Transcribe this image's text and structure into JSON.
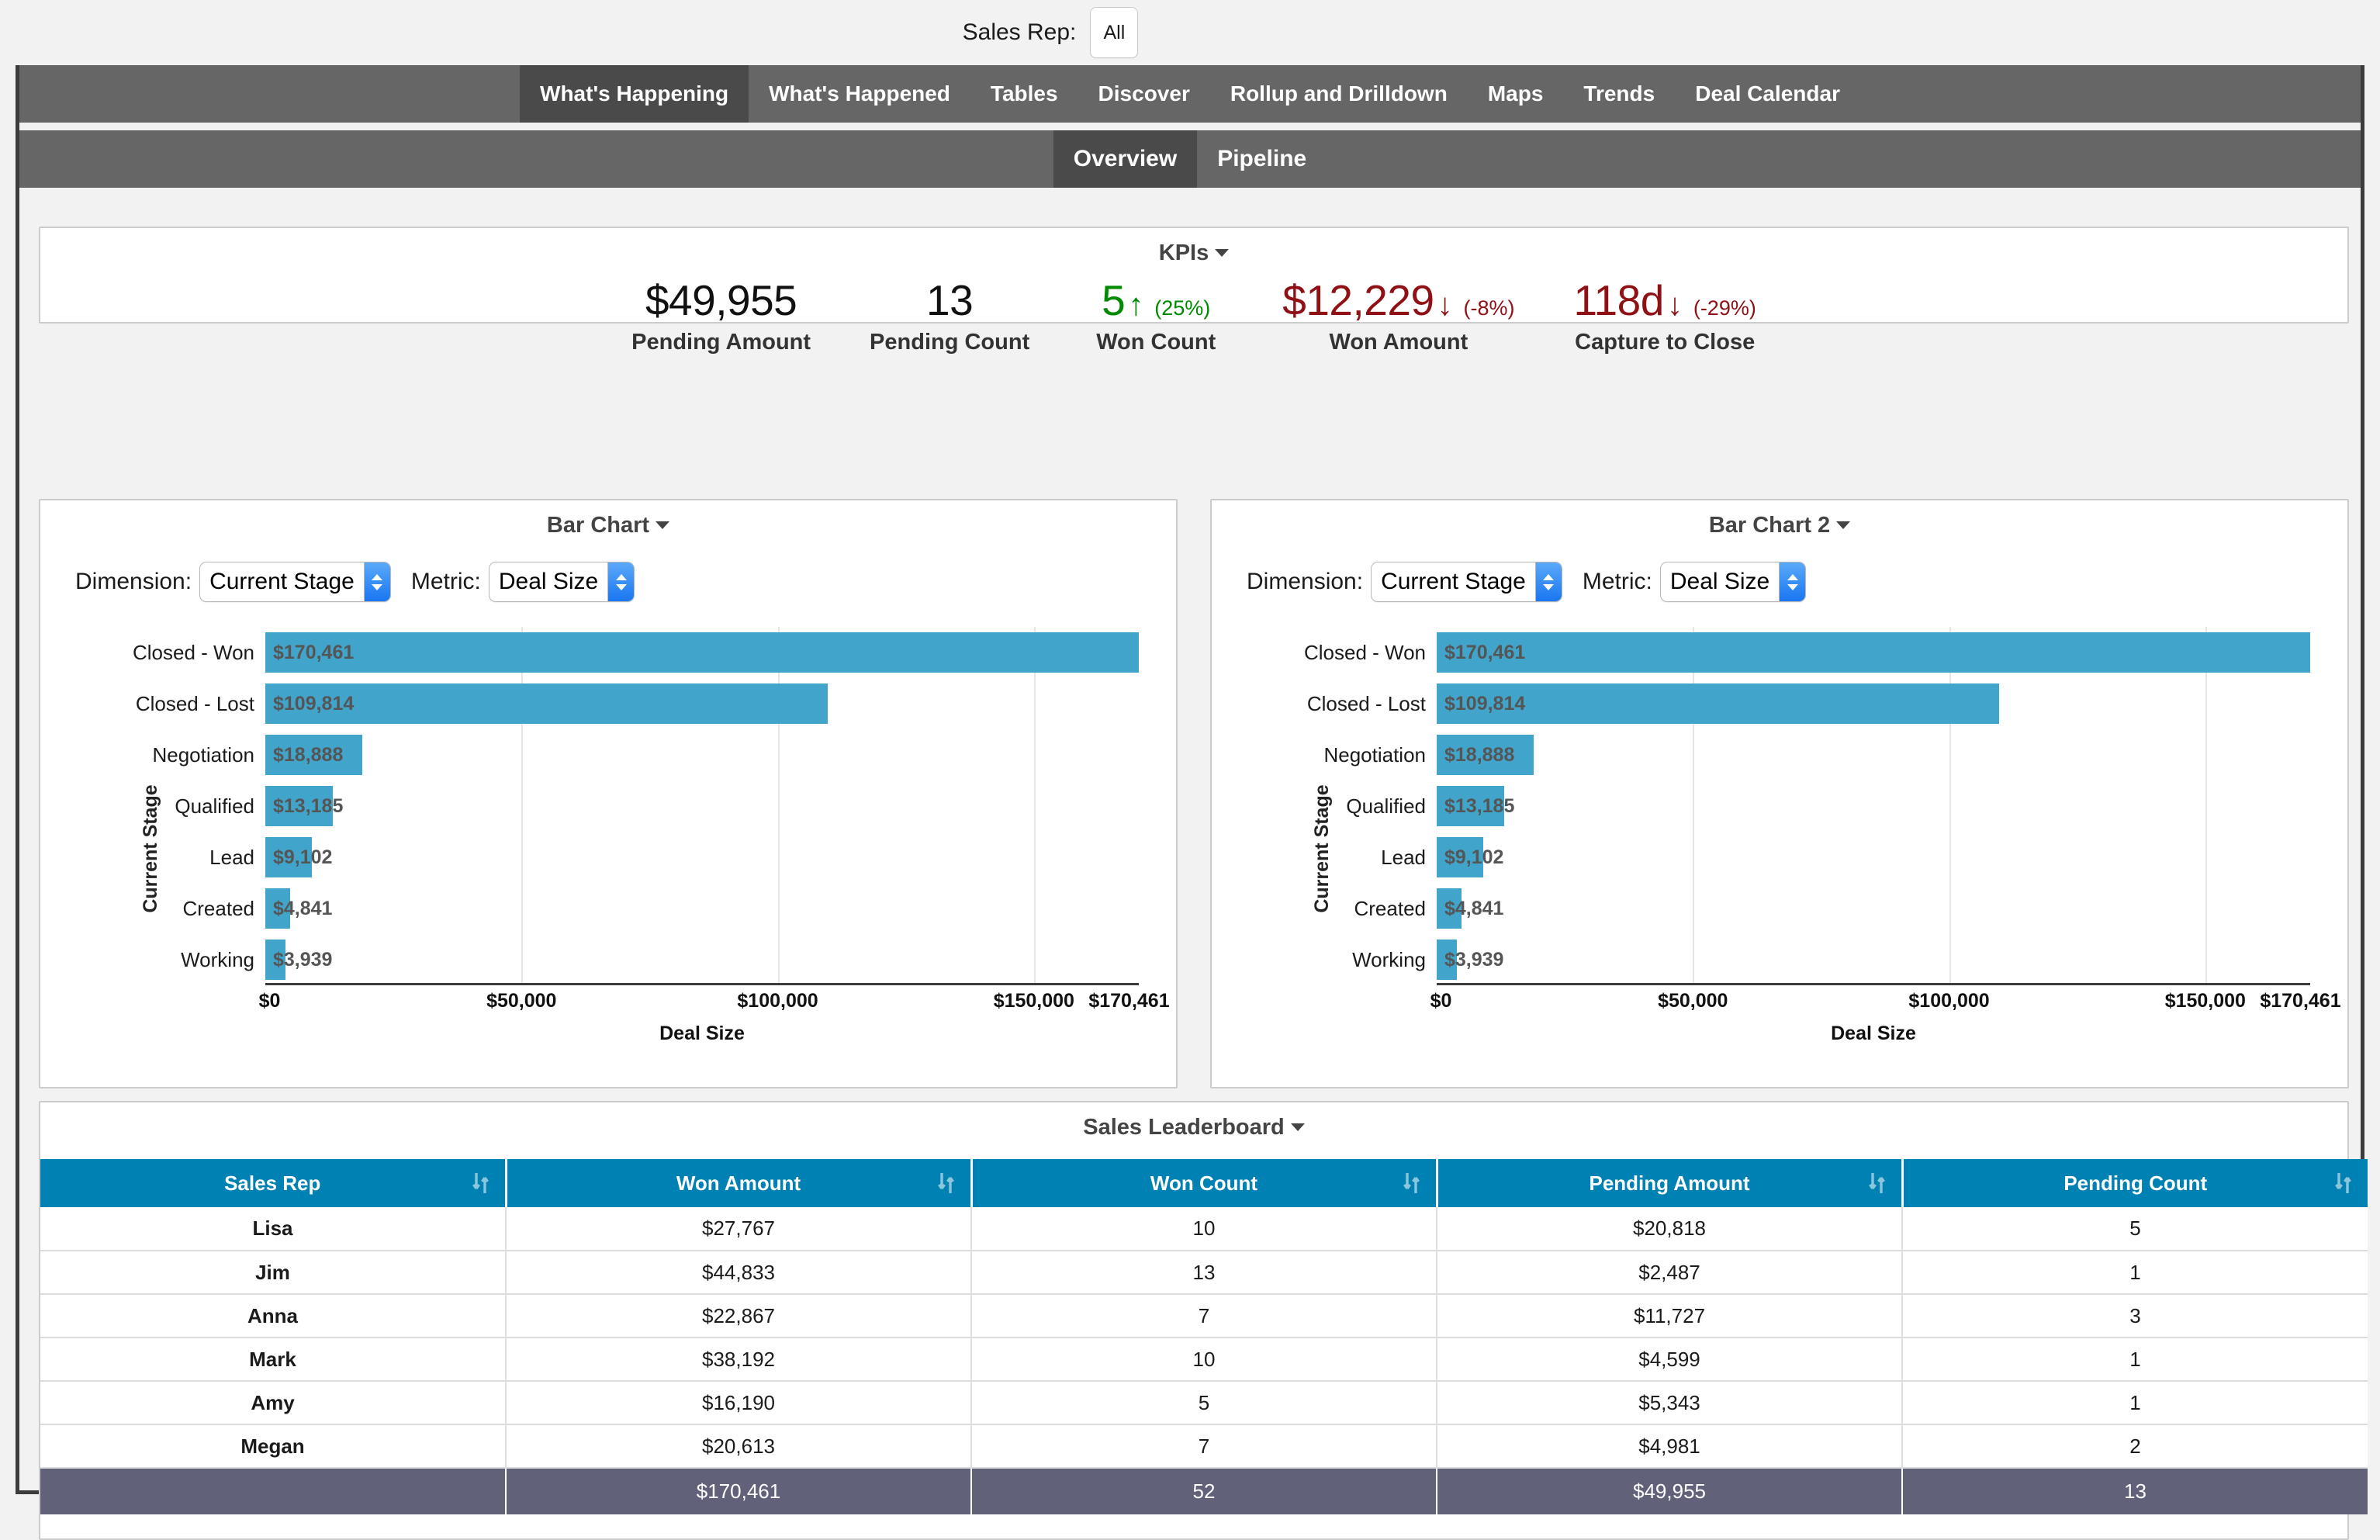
{
  "filter": {
    "label": "Sales Rep:",
    "value": "All"
  },
  "nav": {
    "items": [
      {
        "label": "What's Happening",
        "active": true
      },
      {
        "label": "What's Happened",
        "active": false
      },
      {
        "label": "Tables",
        "active": false
      },
      {
        "label": "Discover",
        "active": false
      },
      {
        "label": "Rollup and Drilldown",
        "active": false
      },
      {
        "label": "Maps",
        "active": false
      },
      {
        "label": "Trends",
        "active": false
      },
      {
        "label": "Deal Calendar",
        "active": false
      }
    ]
  },
  "subnav": {
    "items": [
      {
        "label": "Overview",
        "active": true
      },
      {
        "label": "Pipeline",
        "active": false
      }
    ]
  },
  "kpis": {
    "title": "KPIs",
    "items": [
      {
        "value": "$49,955",
        "label": "Pending Amount",
        "tone": "neutral",
        "arrow": "",
        "delta": ""
      },
      {
        "value": "13",
        "label": "Pending Count",
        "tone": "neutral",
        "arrow": "",
        "delta": ""
      },
      {
        "value": "5",
        "label": "Won Count",
        "tone": "pos",
        "arrow": "↑",
        "delta": "(25%)"
      },
      {
        "value": "$12,229",
        "label": "Won Amount",
        "tone": "neg",
        "arrow": "↓",
        "delta": "(-8%)"
      },
      {
        "value": "118d",
        "label": "Capture to Close",
        "tone": "neg",
        "arrow": "↓",
        "delta": "(-29%)"
      }
    ]
  },
  "chart1": {
    "title": "Bar Chart",
    "dimension_label": "Dimension:",
    "dimension_value": "Current Stage",
    "metric_label": "Metric:",
    "metric_value": "Deal Size"
  },
  "chart2": {
    "title": "Bar Chart 2",
    "dimension_label": "Dimension:",
    "dimension_value": "Current Stage",
    "metric_label": "Metric:",
    "metric_value": "Deal Size"
  },
  "chart_data": {
    "type": "bar",
    "orientation": "horizontal",
    "title": "Bar Chart",
    "xlabel": "Deal Size",
    "ylabel": "Current Stage",
    "grid": true,
    "xlim": [
      0,
      170461
    ],
    "xticks": [
      0,
      50000,
      100000,
      150000,
      170461
    ],
    "xticklabels": [
      "$0",
      "$50,000",
      "$100,000",
      "$150,000",
      "$170,461"
    ],
    "categories": [
      "Closed - Won",
      "Closed - Lost",
      "Negotiation",
      "Qualified",
      "Lead",
      "Created",
      "Working"
    ],
    "values": [
      170461,
      109814,
      18888,
      13185,
      9102,
      4841,
      3939
    ],
    "value_labels": [
      "$170,461",
      "$109,814",
      "$18,888",
      "$13,185",
      "$9,102",
      "$4,841",
      "$3,939"
    ],
    "bar_color": "#41a5cb"
  },
  "leaderboard": {
    "title": "Sales Leaderboard",
    "columns": [
      "Sales Rep",
      "Won Amount",
      "Won Count",
      "Pending Amount",
      "Pending Count"
    ],
    "rows": [
      [
        "Lisa",
        "$27,767",
        "10",
        "$20,818",
        "5"
      ],
      [
        "Jim",
        "$44,833",
        "13",
        "$2,487",
        "1"
      ],
      [
        "Anna",
        "$22,867",
        "7",
        "$11,727",
        "3"
      ],
      [
        "Mark",
        "$38,192",
        "10",
        "$4,599",
        "1"
      ],
      [
        "Amy",
        "$16,190",
        "5",
        "$5,343",
        "1"
      ],
      [
        "Megan",
        "$20,613",
        "7",
        "$4,981",
        "2"
      ]
    ],
    "total": [
      "",
      "$170,461",
      "52",
      "$49,955",
      "13"
    ]
  },
  "colors": {
    "bar": "#41a5cb",
    "table_header": "#0081b4",
    "table_total": "#61627a",
    "nav": "#666666",
    "nav_active": "#4a4a4a",
    "positive": "#008a00",
    "negative": "#8f1015"
  }
}
